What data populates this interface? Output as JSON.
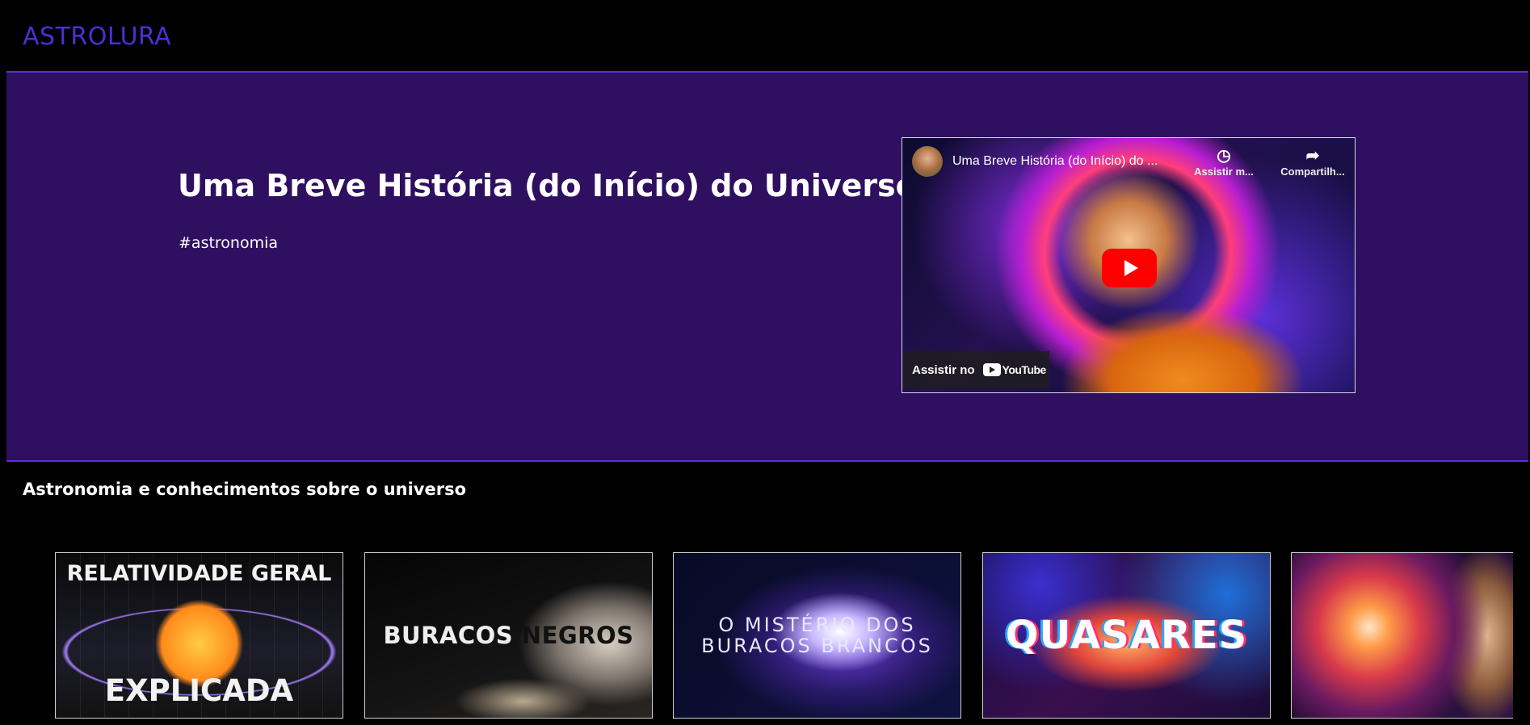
{
  "header": {
    "logo": "ASTROLURA"
  },
  "hero": {
    "title": "Uma Breve História (do Início) do Universo",
    "tag": "#astronomia",
    "video": {
      "title": "Uma Breve História (do Início) do ...",
      "watch_later": "Assistir m...",
      "share": "Compartilh...",
      "watch_on": "Assistir no",
      "platform": "YouTube"
    }
  },
  "section": {
    "title": "Astronomia e conhecimentos sobre o universo"
  },
  "thumbnails": [
    {
      "top": "RELATIVIDADE GERAL",
      "bottom": "EXPLICADA"
    },
    {
      "text_a": "BURACOS ",
      "text_b": "NEGROS"
    },
    {
      "line1": "O MISTÉRIO DOS",
      "line2": "BURACOS BRANCOS"
    },
    {
      "text": "QUASARES"
    },
    {
      "text": ""
    }
  ],
  "colors": {
    "accent": "#4b2fd6",
    "hero_bg": "#2e0f60",
    "youtube_red": "#ff0000"
  }
}
